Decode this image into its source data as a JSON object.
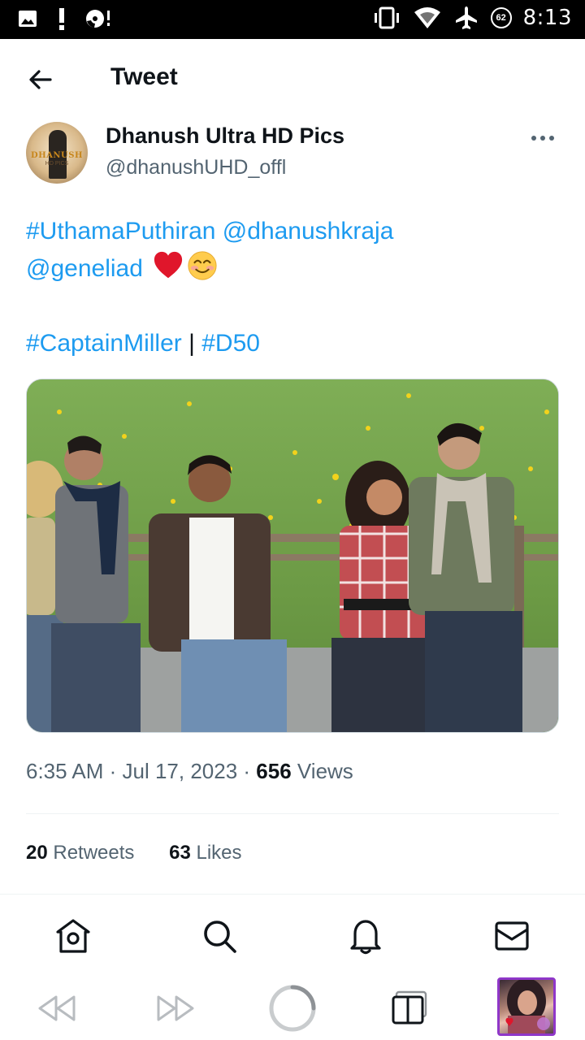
{
  "status_bar": {
    "time": "8:13",
    "battery_level": "62",
    "icons": [
      "image-icon",
      "alert-icon",
      "disc-icon",
      "vibrate-icon",
      "wifi-icon",
      "airplane-icon",
      "battery-icon"
    ]
  },
  "header": {
    "title": "Tweet"
  },
  "author": {
    "name": "Dhanush Ultra HD Pics",
    "handle": "@dhanushUHD_offl",
    "avatar_text": "DHANUSH",
    "avatar_subtext": "HD PICS"
  },
  "tweet": {
    "line1_hashtag": "#UthamaPuthiran",
    "line1_mention": " @dhanushkraja",
    "line2_mention": "@geneliad",
    "line3_hashtag1": "#CaptainMiller",
    "line3_separator": " | ",
    "line3_hashtag2": "#D50",
    "emojis": [
      "red-heart",
      "smiling-face-with-smiling-eyes"
    ]
  },
  "media": {
    "description_icon": "tweet-photo"
  },
  "meta": {
    "time": "6:35 AM",
    "date": "Jul 17, 2023",
    "views_count": "656",
    "views_label": "Views"
  },
  "stats": {
    "retweets_count": "20",
    "retweets_label": "Retweets",
    "likes_count": "63",
    "likes_label": "Likes"
  },
  "bottom_nav": [
    "home-icon",
    "search-icon",
    "bell-icon",
    "mail-icon"
  ],
  "browser_toolbar": [
    "rewind-icon",
    "fast-forward-icon",
    "reload-icon",
    "tabs-icon",
    "tab-thumbnail"
  ],
  "colors": {
    "link": "#1d9bf0",
    "text": "#0f1419",
    "secondary": "#536471",
    "tab_border": "#8f37c9"
  }
}
